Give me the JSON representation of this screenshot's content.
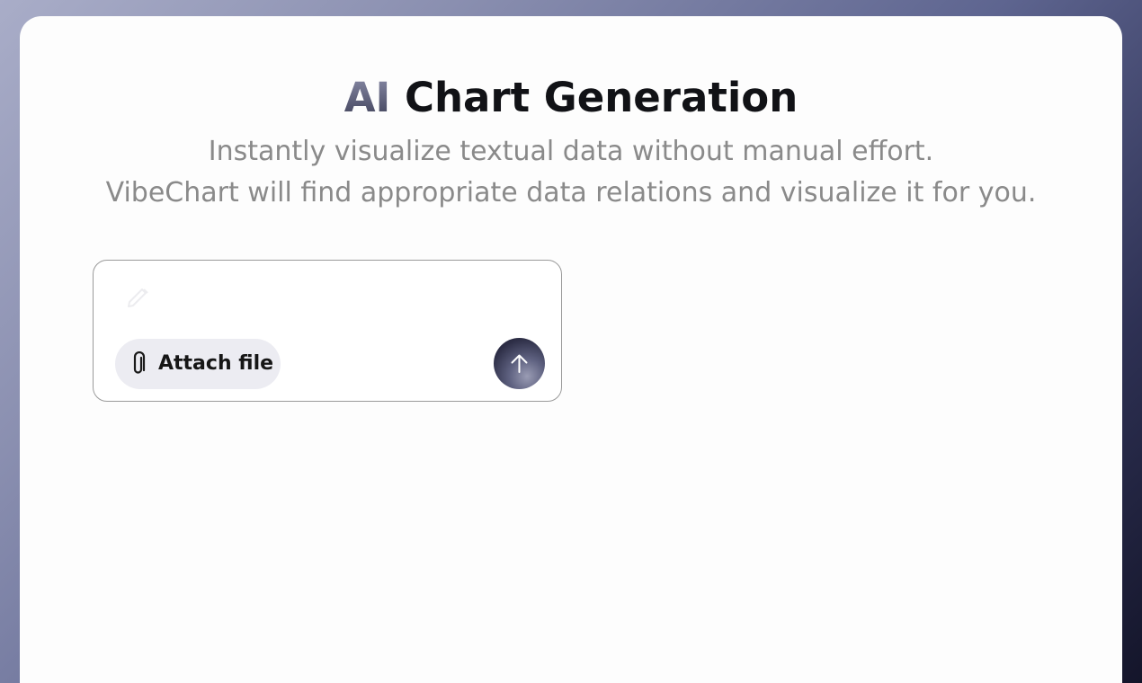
{
  "header": {
    "title_accent": "AI",
    "title_rest": " Chart Generation",
    "subtitle_line1": "Instantly visualize textual data without manual effort.",
    "subtitle_line2": "VibeChart will find appropriate data relations and visualize it for you."
  },
  "prompt": {
    "value": "",
    "placeholder": "",
    "attach_label": "Attach file",
    "icons": {
      "edit": "pencil-icon",
      "attach": "paperclip-icon",
      "send": "arrow-up-icon"
    }
  },
  "colors": {
    "title": "#111216",
    "subtitle": "#8a8a8a",
    "attach_bg": "#ececf2",
    "send_bg": "#2c2d45"
  }
}
